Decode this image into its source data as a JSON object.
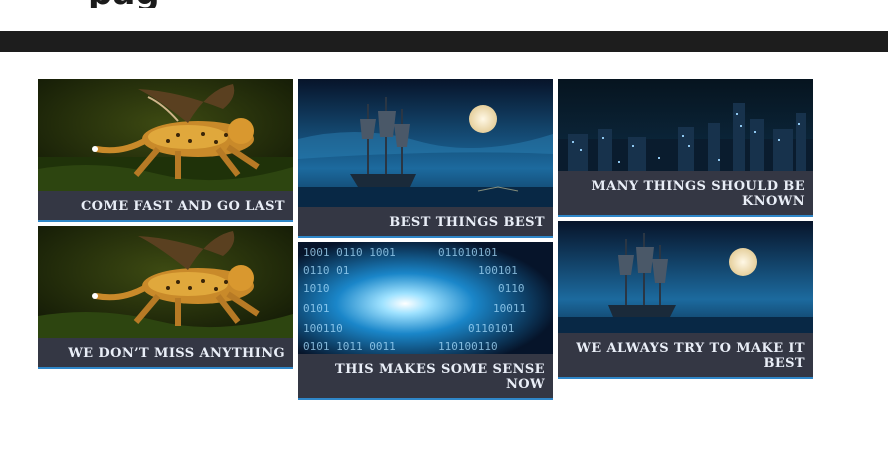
{
  "page": {
    "title_fragment": "pag"
  },
  "gallery": {
    "cards": [
      {
        "caption": "COME FAST AND GO LAST",
        "image": "cheetah-image"
      },
      {
        "caption": "WE DON’T MISS ANYTHING",
        "image": "cheetah-image"
      },
      {
        "caption": "BEST THINGS BEST",
        "image": "ship-moon-image"
      },
      {
        "caption": "THIS MAKES SOME SENSE NOW",
        "image": "binary-tunnel-image"
      },
      {
        "caption": "MANY THINGS SHOULD BE KNOWN",
        "image": "city-night-image"
      },
      {
        "caption": "WE ALWAYS TRY TO MAKE IT BEST",
        "image": "ship-moon-image"
      }
    ]
  },
  "colors": {
    "caption_bg": "#343744",
    "caption_text": "#e9eef7",
    "accent_border": "#2f87c9",
    "top_bar": "#1d1d1d"
  }
}
